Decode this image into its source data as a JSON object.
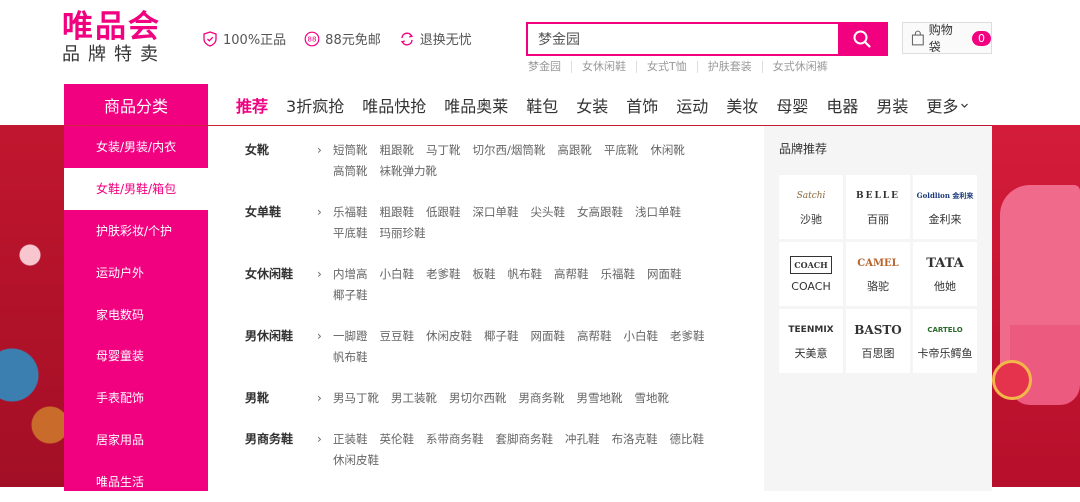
{
  "logo": {
    "main": "唯品会",
    "sub": "品牌特卖"
  },
  "promises": [
    {
      "icon": "shield-icon",
      "label": "100%正品"
    },
    {
      "icon": "shipping-88-icon",
      "label": "88元免邮"
    },
    {
      "icon": "return-icon",
      "label": "退换无忧"
    }
  ],
  "search": {
    "value": "梦金园",
    "hot_words": [
      "梦金园",
      "女休闲鞋",
      "女式T恤",
      "护肤套装",
      "女式休闲裤"
    ]
  },
  "cart": {
    "label": "购物袋",
    "count": "0"
  },
  "nav": {
    "category_title": "商品分类",
    "items": [
      "推荐",
      "3折疯抢",
      "唯品快抢",
      "唯品奥莱",
      "鞋包",
      "女装",
      "首饰",
      "运动",
      "美妆",
      "母婴",
      "电器",
      "男装"
    ],
    "more": "更多"
  },
  "sidebar": [
    "女装/男装/内衣",
    "女鞋/男鞋/箱包",
    "护肤彩妆/个护",
    "运动户外",
    "家电数码",
    "母婴童装",
    "手表配饰",
    "居家用品",
    "唯品生活"
  ],
  "subcategories": [
    {
      "title": "女靴",
      "links": [
        "短筒靴",
        "粗跟靴",
        "马丁靴",
        "切尔西/烟筒靴",
        "高跟靴",
        "平底靴",
        "休闲靴",
        "高筒靴",
        "袜靴弹力靴"
      ]
    },
    {
      "title": "女单鞋",
      "links": [
        "乐福鞋",
        "粗跟鞋",
        "低跟鞋",
        "深口单鞋",
        "尖头鞋",
        "女高跟鞋",
        "浅口单鞋",
        "平底鞋",
        "玛丽珍鞋"
      ]
    },
    {
      "title": "女休闲鞋",
      "links": [
        "内增高",
        "小白鞋",
        "老爹鞋",
        "板鞋",
        "帆布鞋",
        "高帮鞋",
        "乐福鞋",
        "网面鞋",
        "椰子鞋"
      ]
    },
    {
      "title": "男休闲鞋",
      "links": [
        "一脚蹬",
        "豆豆鞋",
        "休闲皮鞋",
        "椰子鞋",
        "网面鞋",
        "高帮鞋",
        "小白鞋",
        "老爹鞋",
        "帆布鞋"
      ]
    },
    {
      "title": "男靴",
      "links": [
        "男马丁靴",
        "男工装靴",
        "男切尔西靴",
        "男商务靴",
        "男雪地靴",
        "雪地靴"
      ]
    },
    {
      "title": "男商务鞋",
      "links": [
        "正装鞋",
        "英伦鞋",
        "系带商务鞋",
        "套脚商务鞋",
        "冲孔鞋",
        "布洛克鞋",
        "德比鞋",
        "休闲皮鞋"
      ]
    }
  ],
  "brands": {
    "title": "品牌推荐",
    "items": [
      {
        "logo": "Satchi",
        "name": "沙驰"
      },
      {
        "logo": "BELLE",
        "name": "百丽"
      },
      {
        "logo": "Goldlion 金利来",
        "name": "金利来"
      },
      {
        "logo": "COACH",
        "name": "COACH"
      },
      {
        "logo": "CAMEL",
        "name": "骆驼"
      },
      {
        "logo": "TATA",
        "name": "他她"
      },
      {
        "logo": "TEENMIX",
        "name": "天美意"
      },
      {
        "logo": "BASTO",
        "name": "百思图"
      },
      {
        "logo": "CARTELO",
        "name": "卡帝乐鳄鱼"
      }
    ]
  },
  "colors": {
    "brand": "#f10180",
    "banner": "#c21532"
  }
}
